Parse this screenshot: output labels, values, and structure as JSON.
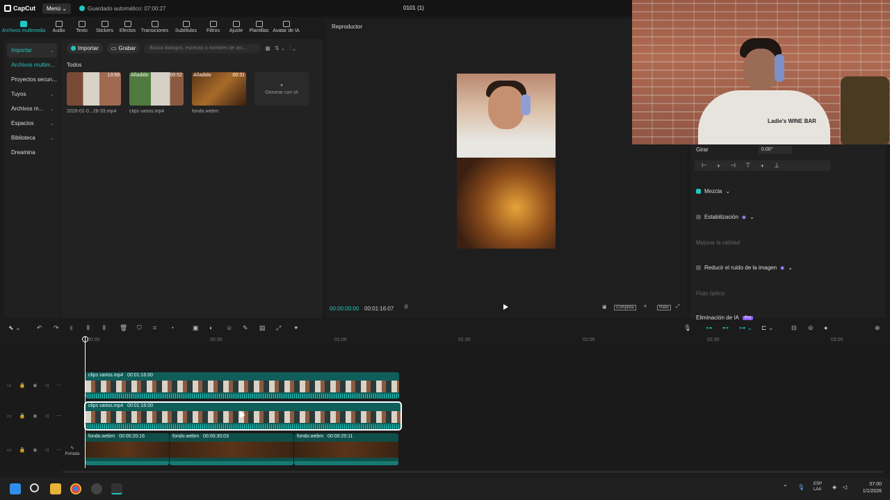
{
  "app": {
    "logo": "CapCut",
    "menu_label": "Menú",
    "autosave_text": "Guardado automático: 07:00:27",
    "project_title": "0101 (1)"
  },
  "toolbar": [
    {
      "label": "Archivos multimedia",
      "icon": "media-icon",
      "active": true
    },
    {
      "label": "Audio",
      "icon": "audio-icon"
    },
    {
      "label": "Texto",
      "icon": "text-icon"
    },
    {
      "label": "Stickers",
      "icon": "sticker-icon"
    },
    {
      "label": "Efectos",
      "icon": "effects-icon"
    },
    {
      "label": "Transiciones",
      "icon": "transitions-icon"
    },
    {
      "label": "Subtítulos",
      "icon": "subtitles-icon"
    },
    {
      "label": "Filtros",
      "icon": "filters-icon"
    },
    {
      "label": "Ajuste",
      "icon": "adjust-icon"
    },
    {
      "label": "Plantillas",
      "icon": "templates-icon"
    },
    {
      "label": "Avatar de IA",
      "icon": "ai-avatar-icon"
    }
  ],
  "leftnav": [
    {
      "label": "Importar",
      "chev": "⌄"
    },
    {
      "label": "Archivos multim..."
    },
    {
      "label": "Proyectos secun..."
    },
    {
      "label": "Tuyos",
      "chev": "⌄"
    },
    {
      "label": "Archivos m...",
      "chev": "⌄"
    },
    {
      "label": "Espacios",
      "chev": "⌄"
    },
    {
      "label": "Biblioteca",
      "chev": "⌄"
    },
    {
      "label": "Dreamina"
    }
  ],
  "media": {
    "import_label": "Importar",
    "record_label": "Grabar",
    "search_placeholder": "Busca diálogos, escenas o nombres de arc...",
    "section_title": "Todos",
    "items": [
      {
        "name": "2026-01-0...28-33.mp4",
        "tag": "",
        "duration": "13:59"
      },
      {
        "name": "clips varios.mp4",
        "tag": "Añadido",
        "duration": "00:52"
      },
      {
        "name": "fondo.webm",
        "tag": "Añadido",
        "duration": "00:31"
      }
    ],
    "ai_card_label": "Generar con IA"
  },
  "player": {
    "title": "Reproductor",
    "current_time": "00:00:00:00",
    "total_time": "00:01:16:07",
    "ratio_label": "Completa",
    "ratio_box": "Ratio"
  },
  "inspector": {
    "rotate_label": "Girar",
    "rotate_value": "0.00°",
    "blend_label": "Mezcla",
    "stabilization_label": "Estabilización",
    "improve_quality_label": "Mejorar la calidad",
    "reduce_noise_label": "Reducir el ruido de la imagen",
    "optical_flow_label": "Flujo óptico",
    "remove_label": "Eliminación de IA",
    "remove_badge": "Pro"
  },
  "webcam": {
    "shirt_text": "Ladie's WINE BAR"
  },
  "timeline": {
    "ruler_ticks": [
      "00:00",
      "00:30",
      "01:00",
      "01:30",
      "02:00",
      "02:30",
      "03:00"
    ],
    "tracks": [
      {
        "clips": [
          {
            "name": "clips varios.mp4",
            "duration": "00:01:16:00"
          }
        ]
      },
      {
        "clips": [
          {
            "name": "clips varios.mp4",
            "duration": "00:01:16:00"
          }
        ]
      },
      {
        "clips": [
          {
            "name": "fondo.webm",
            "duration": "00:00:20:16"
          },
          {
            "name": "fondo.webm",
            "duration": "00:00:30:03"
          },
          {
            "name": "fondo.webm",
            "duration": "00:00:25:11"
          }
        ]
      }
    ],
    "cover_label": "Portada"
  },
  "taskbar": {
    "lang_top": "ESP",
    "lang_bottom": "LAA",
    "time": "07:00",
    "date": "1/1/2026"
  },
  "colors": {
    "accent": "#1fc8c0",
    "pro": "#8b5cf6"
  }
}
